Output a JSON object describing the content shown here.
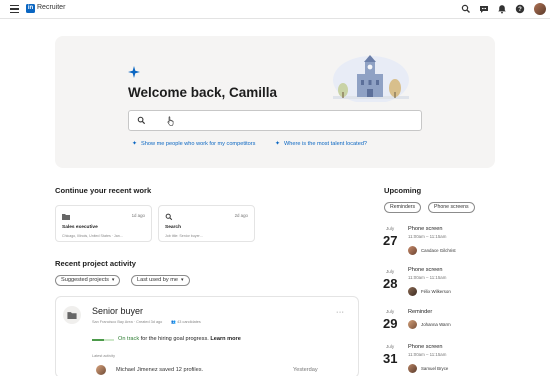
{
  "header": {
    "logo_text": "in",
    "app_name": "Recruiter",
    "icons": [
      "menu-icon",
      "search-icon",
      "messages-icon",
      "notifications-icon",
      "help-icon",
      "profile-avatar"
    ]
  },
  "hero": {
    "welcome": "Welcome back, Camilla",
    "search_placeholder": "",
    "suggestions": [
      "Show me people who work for my competitors",
      "Where is the most talent located?"
    ]
  },
  "recent_work": {
    "title": "Continue your recent work",
    "cards": [
      {
        "icon": "folder-icon",
        "age": "1d ago",
        "title": "Sales executive",
        "subtitle": "Chicago, Illinois, United States · Jan…"
      },
      {
        "icon": "search-icon",
        "age": "2d ago",
        "title": "Search",
        "subtitle": "Job title: Senior buyer…"
      }
    ]
  },
  "projects": {
    "title": "Recent project activity",
    "filters": [
      {
        "label": "Suggested projects",
        "caret": "▾"
      },
      {
        "label": "Last used by me",
        "caret": "▾"
      }
    ],
    "card": {
      "title": "Senior buyer",
      "meta": "San Francisco Bay Area · Created 3d ago",
      "candidates": "43 candidates",
      "more": "···",
      "progress": 0.55,
      "status_green": "On track",
      "status_text": " for the hiring goal progress.",
      "status_link": "Learn more",
      "latest_label": "Latest activity",
      "activity": "Michael Jimenez saved 12 profiles.",
      "activity_date": "Yesterday"
    }
  },
  "upcoming": {
    "title": "Upcoming",
    "tabs": [
      "Reminders",
      "Phone screens"
    ],
    "events": [
      {
        "month": "July",
        "day": "27",
        "title": "Phone screen",
        "time": "11:00am – 11:15am",
        "person": "Candace Gilchrist"
      },
      {
        "month": "July",
        "day": "28",
        "title": "Phone screen",
        "time": "11:00am – 11:15am",
        "person": "Félix Wilkerson"
      },
      {
        "month": "July",
        "day": "29",
        "title": "Reminder",
        "time": "",
        "person": "Johanna Warm"
      },
      {
        "month": "July",
        "day": "31",
        "title": "Phone screen",
        "time": "11:00am – 11:15am",
        "person": "Samuel Bryce"
      }
    ]
  },
  "colors": {
    "accent": "#0a66c2",
    "success": "#2e7d32",
    "hero_bg": "#f5f4f3"
  }
}
